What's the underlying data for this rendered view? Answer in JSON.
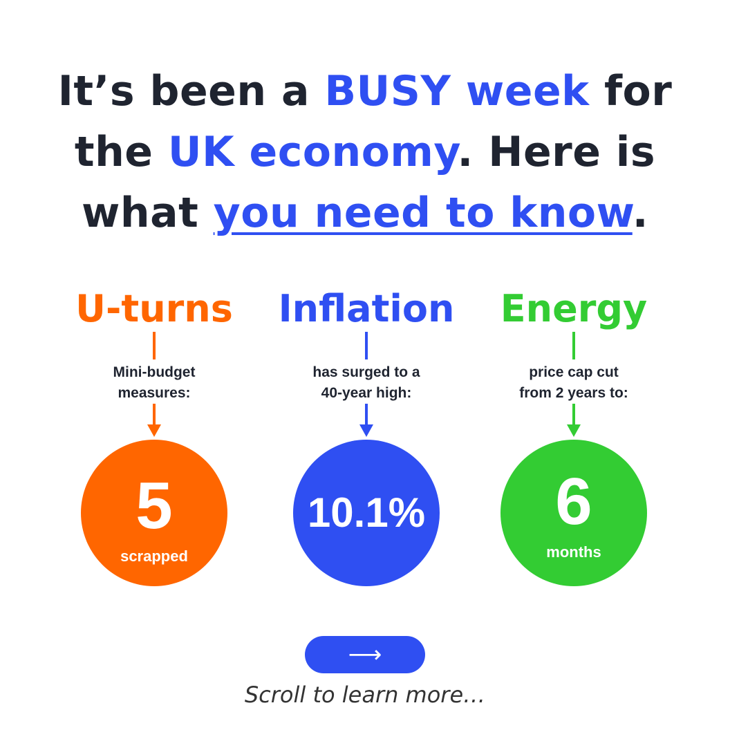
{
  "headline": {
    "line1_a": "It’s been a ",
    "line1_accent": "BUSY week",
    "line1_b": " for",
    "line2_a": "the ",
    "line2_accent": "UK economy",
    "line2_b": ". Here is",
    "line3_a": "what ",
    "line3_link": "you need to know",
    "line3_b": "."
  },
  "colors": {
    "dark": "#1f2430",
    "blue": "#2f4ff2",
    "orange": "#ff6600",
    "green": "#33cc33"
  },
  "stats": [
    {
      "title": "U-turns",
      "desc_line1": "Mini-budget",
      "desc_line2": "measures:",
      "value": "5",
      "unit": "scrapped",
      "color": "#ff6600"
    },
    {
      "title": "Inflation",
      "desc_line1": "has surged to a",
      "desc_line2": "40-year high:",
      "value": "10.1%",
      "unit": "",
      "color": "#2f4ff2"
    },
    {
      "title": "Energy",
      "desc_line1": "price cap cut",
      "desc_line2": "from 2 years to:",
      "value": "6",
      "unit": "months",
      "color": "#33cc33"
    }
  ],
  "cta": {
    "icon": "right-arrow-icon",
    "arrow_glyph": "⟶"
  },
  "footer": {
    "scroll_text": "Scroll to learn more…"
  }
}
